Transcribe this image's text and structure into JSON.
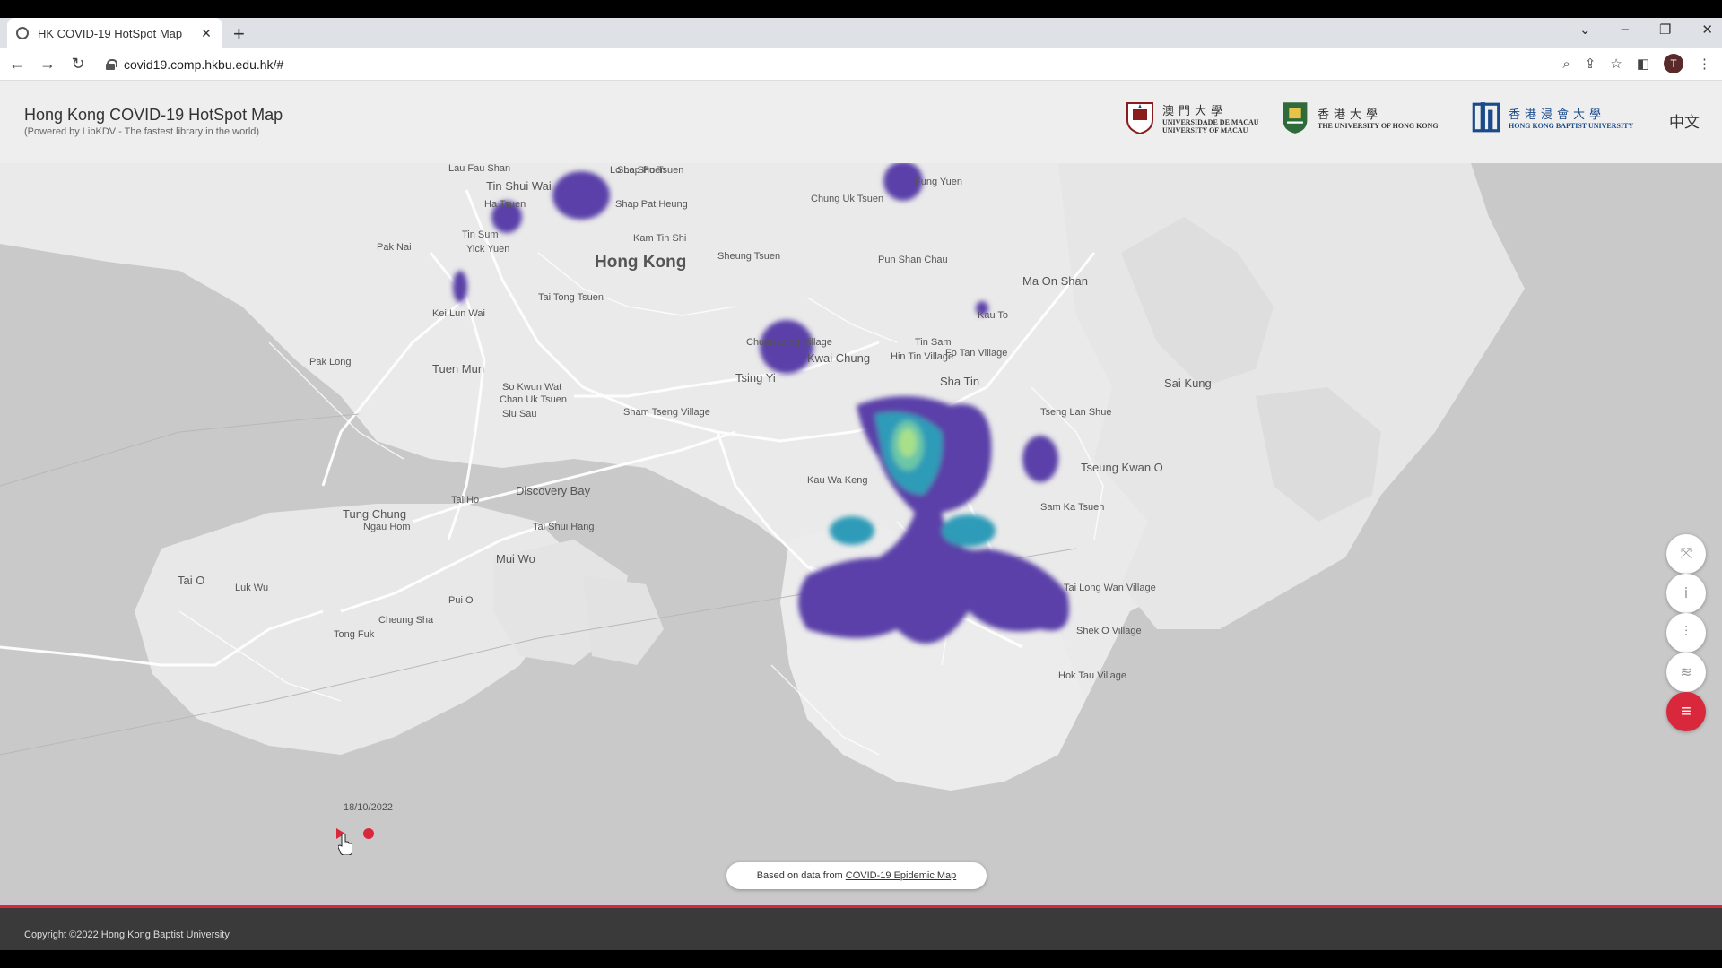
{
  "browser": {
    "tab_title": "HK COVID-19 HotSpot Map",
    "url": "covid19.comp.hkbu.edu.hk/#",
    "profile_initial": "T"
  },
  "header": {
    "title": "Hong Kong COVID-19 HotSpot Map",
    "subtitle": "(Powered by LibKDV - The fastest library in the world)",
    "logos": {
      "um": {
        "cn": "澳門大學",
        "en1": "UNIVERSIDADE DE MACAU",
        "en2": "UNIVERSITY OF MACAU"
      },
      "hku": {
        "cn": "香港大學",
        "en": "THE UNIVERSITY OF HONG KONG"
      },
      "hkbu": {
        "cn": "香港浸會大學",
        "en": "HONG KONG BAPTIST UNIVERSITY"
      }
    },
    "language_toggle": "中文"
  },
  "map": {
    "labels": [
      {
        "text": "Hong Kong",
        "size": "big"
      },
      {
        "text": "Tin Shui Wai"
      },
      {
        "text": "Lau Fau Shan"
      },
      {
        "text": "Ha Tsuen"
      },
      {
        "text": "Lo Lo Shuen"
      },
      {
        "text": "Shap Pat Heung"
      },
      {
        "text": "Tin Sum"
      },
      {
        "text": "Yick Yuen"
      },
      {
        "text": "Pak Nai"
      },
      {
        "text": "Kam Tin Shi"
      },
      {
        "text": "Shap Po Tsuen"
      },
      {
        "text": "Tai Tong Tsuen"
      },
      {
        "text": "Sheung Tsuen"
      },
      {
        "text": "Chung Uk Tsuen"
      },
      {
        "text": "Pun Shan Chau"
      },
      {
        "text": "Fung Yuen"
      },
      {
        "text": "Ma On Shan",
        "size": "mid"
      },
      {
        "text": "Kau To"
      },
      {
        "text": "Fo Tan Village"
      },
      {
        "text": "Sha Tin",
        "size": "mid"
      },
      {
        "text": "Sai Kung",
        "size": "mid"
      },
      {
        "text": "Kei Lun Wai"
      },
      {
        "text": "Pak Long"
      },
      {
        "text": "Tuen Mun",
        "size": "mid"
      },
      {
        "text": "So Kwun Wat"
      },
      {
        "text": "Chan Uk Tsuen"
      },
      {
        "text": "Siu Sau"
      },
      {
        "text": "Sham Tseng Village"
      },
      {
        "text": "Chuen Lung Village"
      },
      {
        "text": "Kau Wa Keng"
      },
      {
        "text": "Tsing Yi",
        "size": "mid"
      },
      {
        "text": "Kwai Chung",
        "size": "mid"
      },
      {
        "text": "Hin Tin Village"
      },
      {
        "text": "Tin Sam"
      },
      {
        "text": "Tseng Lan Shue"
      },
      {
        "text": "Tseung Kwan O",
        "size": "mid"
      },
      {
        "text": "Sam Ka Tsuen"
      },
      {
        "text": "Discovery Bay",
        "size": "mid"
      },
      {
        "text": "Tai Ho"
      },
      {
        "text": "Tung Chung",
        "size": "mid"
      },
      {
        "text": "Tai Shui Hang"
      },
      {
        "text": "Ngau Hom"
      },
      {
        "text": "Mui Wo",
        "size": "mid"
      },
      {
        "text": "Tai O",
        "size": "mid"
      },
      {
        "text": "Luk Wu"
      },
      {
        "text": "Pui O"
      },
      {
        "text": "Cheung Sha"
      },
      {
        "text": "Tong Fuk"
      },
      {
        "text": "Tai Long Wan Village"
      },
      {
        "text": "Shek O Village"
      },
      {
        "text": "Hok Tau Village"
      }
    ]
  },
  "timeline": {
    "date": "18/10/2022"
  },
  "source": {
    "prefix": "Based on data from ",
    "link": "COVID-19 Epidemic Map"
  },
  "footer": {
    "copyright": "Copyright ©2022 Hong Kong Baptist University"
  },
  "colors": {
    "accent": "#d9283c",
    "hotspot_low": "#5a3fa8",
    "hotspot_mid": "#2f9bb8",
    "hotspot_high": "#a8e08a"
  },
  "icons": {
    "fullscreen": "fullscreen-icon",
    "info": "info-icon",
    "filter": "sliders-icon",
    "layers": "layers-icon",
    "menu": "menu-icon"
  }
}
